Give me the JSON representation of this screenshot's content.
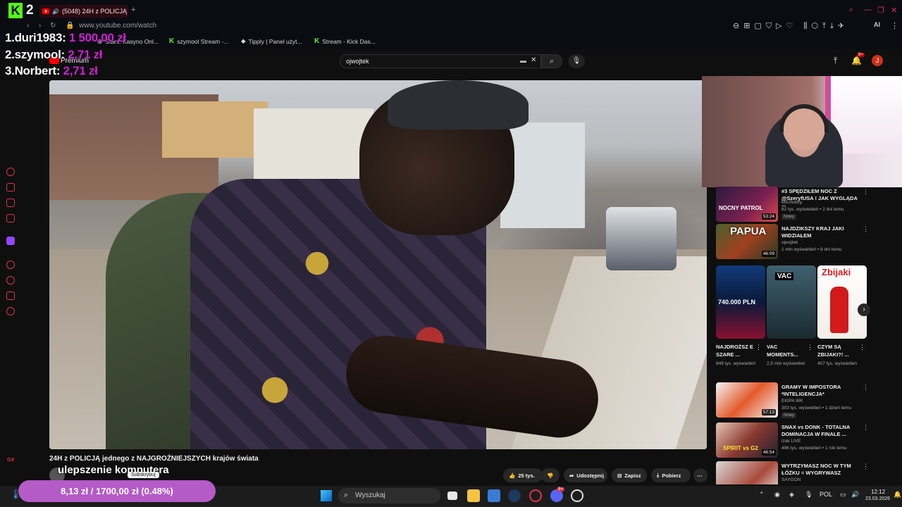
{
  "browser": {
    "tab_title": "(5048) 24H z POLICJĄ",
    "url": "www.youtube.com/watch",
    "bookmarks": [
      "Stars: Kasyno Onl...",
      "szymool Stream -...",
      "Tipply | Panel użyt...",
      "Stream - Kick Das..."
    ],
    "window_controls": [
      "search",
      "minimize",
      "maximize",
      "close"
    ]
  },
  "overlay": {
    "kick_logo": "K",
    "kick_number": "2",
    "leaderboard": [
      {
        "rank_name": "1.duri1983:",
        "amount": "1 500,00 zł"
      },
      {
        "rank_name": "2.szymool:",
        "amount": "2,71 zł"
      },
      {
        "rank_name": "3.Norbert:",
        "amount": "2,71 zł"
      }
    ],
    "upgrade_text": "ulepszenie komputera",
    "subscribe_label": "Subskrybuj",
    "goal_text": "8,13 zł / 1700,00 zł (0.48%)"
  },
  "youtube": {
    "premium_label": "Premium",
    "search_value": "ojwojtek",
    "notification_count": "9+",
    "avatar_letter": "J",
    "video_title": "24H z POLICJĄ jednego z NAJGROŹNIEJSZYCH krajów świata",
    "actions": {
      "likes": "25 tys.",
      "share": "Udostępnij",
      "save": "Zapisz",
      "download": "Pobierz"
    },
    "recommendations_top": [
      {
        "title": "#3 SPĘDZIŁEM NOC Z @SzeryfUSA ! JAK WYGLĄDA ...",
        "channel": "MILIholicy",
        "meta": "82 tys. wyświetleń • 2 dni temu",
        "badge": "Nowy",
        "duration": "53:24",
        "thumb_label": "NOCNY PATROL"
      },
      {
        "title": "NAJDZIKSZY KRAJ JAKI WIDZIAŁEM",
        "channel": "ojwojtek",
        "meta": "1 mln wyświetleń • 8 dni temu",
        "badge": "",
        "duration": "46:09",
        "thumb_label": "PAPUA"
      }
    ],
    "shorts": [
      {
        "title": "NAJDROŻSZ E SZARE ...",
        "meta": "849 tys. wyświetleń",
        "thumb_label": "740.000 PLN"
      },
      {
        "title": "VAC MOMENTS...",
        "meta": "2,5 mln wyświetleń",
        "thumb_label": "VAC"
      },
      {
        "title": "CZYM SĄ ZBIJAKI?! ...",
        "meta": "407 tys. wyświetleń",
        "thumb_label": "Zbijaki"
      }
    ],
    "recommendations_bottom": [
      {
        "title": "GRAMY W IMPOSTORA *INTELIGENCJA*",
        "channel": "EKIPA WK",
        "meta": "303 tys. wyświetleń • 1 dzień temu",
        "badge": "Nowy",
        "duration": "57:13",
        "thumb_label": ""
      },
      {
        "title": "SNAX vs DONK - TOTALNA DOMINACJA W FINALE ...",
        "channel": "izak LIVE",
        "meta": "496 tys. wyświetleń • 1 rok temu",
        "badge": "",
        "duration": "48:54",
        "thumb_label": "SPIRIT vs G2"
      },
      {
        "title": "WYTRZYMASZ NOC W TYM ŁÓŻKU = WYGRYWASZ",
        "channel": "SAYGON",
        "meta": "",
        "badge": "",
        "duration": "",
        "thumb_label": ""
      }
    ]
  },
  "taskbar": {
    "search_placeholder": "Wyszukaj",
    "language": "POL",
    "time": "12:12",
    "date": "23.03.2026",
    "discord_badge": "9+"
  },
  "colors": {
    "accent_red": "#e0324a",
    "kick_green": "#53fc18",
    "leaderboard_amount": "#d21ed8",
    "goal_bar": "#b45bc8"
  }
}
